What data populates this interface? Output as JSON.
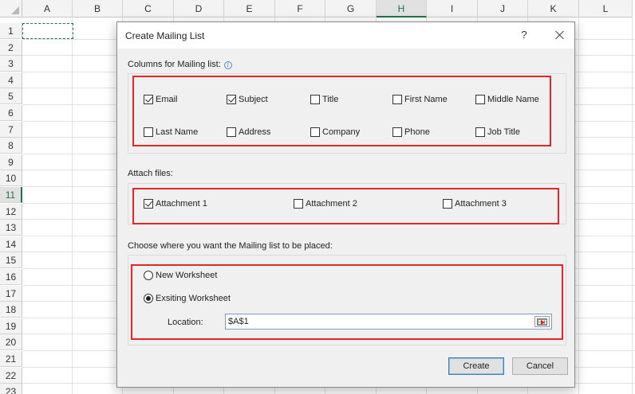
{
  "spreadsheet": {
    "columns": [
      "A",
      "B",
      "C",
      "D",
      "E",
      "F",
      "G",
      "H",
      "I",
      "J",
      "K",
      "L"
    ],
    "rows": [
      "1",
      "2",
      "3",
      "4",
      "5",
      "6",
      "7",
      "8",
      "9",
      "10",
      "11",
      "12",
      "13",
      "14",
      "15",
      "16",
      "17",
      "18",
      "19",
      "20",
      "21",
      "22",
      "23"
    ],
    "selected_column": "H",
    "selected_row": "11"
  },
  "dialog": {
    "title": "Create Mailing List",
    "help_label": "?",
    "columns_section": {
      "label": "Columns for Mailing list:",
      "fields": [
        {
          "label": "Email",
          "checked": true
        },
        {
          "label": "Subject",
          "checked": true
        },
        {
          "label": "Title",
          "checked": false
        },
        {
          "label": "First Name",
          "checked": false
        },
        {
          "label": "Middle Name",
          "checked": false
        },
        {
          "label": "Last Name",
          "checked": false
        },
        {
          "label": "Address",
          "checked": false
        },
        {
          "label": "Company",
          "checked": false
        },
        {
          "label": "Phone",
          "checked": false
        },
        {
          "label": "Job Title",
          "checked": false
        }
      ]
    },
    "attach_section": {
      "label": "Attach files:",
      "files": [
        {
          "label": "Attachment 1",
          "checked": true
        },
        {
          "label": "Attachment 2",
          "checked": false
        },
        {
          "label": "Attachment 3",
          "checked": false
        }
      ]
    },
    "placement_section": {
      "label": "Choose where you want the Mailing list to be placed:",
      "options": [
        {
          "label": "New Worksheet",
          "selected": false
        },
        {
          "label": "Exsiting Worksheet",
          "selected": true
        }
      ],
      "location_label": "Location:",
      "location_value": "$A$1"
    },
    "buttons": {
      "create": "Create",
      "cancel": "Cancel"
    }
  },
  "colors": {
    "highlight": "#e3252c",
    "excel_green": "#217346",
    "dialog_bg": "#f0f0f0"
  }
}
